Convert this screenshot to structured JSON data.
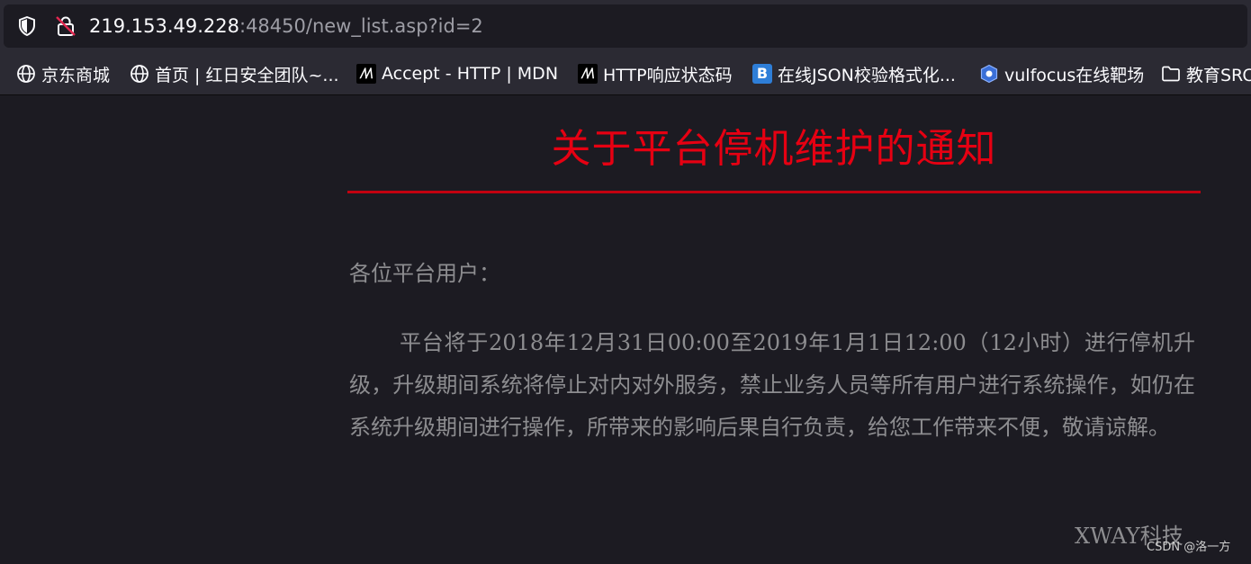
{
  "address_bar": {
    "url_host": "219.153.49.228",
    "url_rest": ":48450/new_list.asp?id=2"
  },
  "bookmarks": [
    {
      "label": "京东商城",
      "icon": "globe-icon"
    },
    {
      "label": "首页 | 红日安全团队~...",
      "icon": "globe-icon"
    },
    {
      "label": "Accept - HTTP | MDN",
      "icon": "mdn-icon"
    },
    {
      "label": "HTTP响应状态码",
      "icon": "mdn-icon"
    },
    {
      "label": "在线JSON校验格式化...",
      "icon": "bejson-icon"
    },
    {
      "label": "vulfocus在线靶场",
      "icon": "vulfocus-icon"
    },
    {
      "label": "教育SRC",
      "icon": "folder-icon"
    }
  ],
  "article": {
    "title": "关于平台停机维护的通知",
    "greeting": "各位平台用户：",
    "body": "平台将于2018年12月31日00:00至2019年1月1日12:00（12小时）进行停机升级，升级期间系统将停止对内对外服务，禁止业务人员等所有用户进行系统操作，如仍在系统升级期间进行操作，所带来的影响后果自行负责，给您工作带来不便，敬请谅解。",
    "signature": "XWAY科技"
  },
  "watermark": "CSDN @洛一方",
  "colors": {
    "title": "#e60012",
    "rule": "#c20010",
    "text": "#8d8d90",
    "page_bg": "#1c1b22",
    "toolbar_bg": "#2b2a33"
  }
}
